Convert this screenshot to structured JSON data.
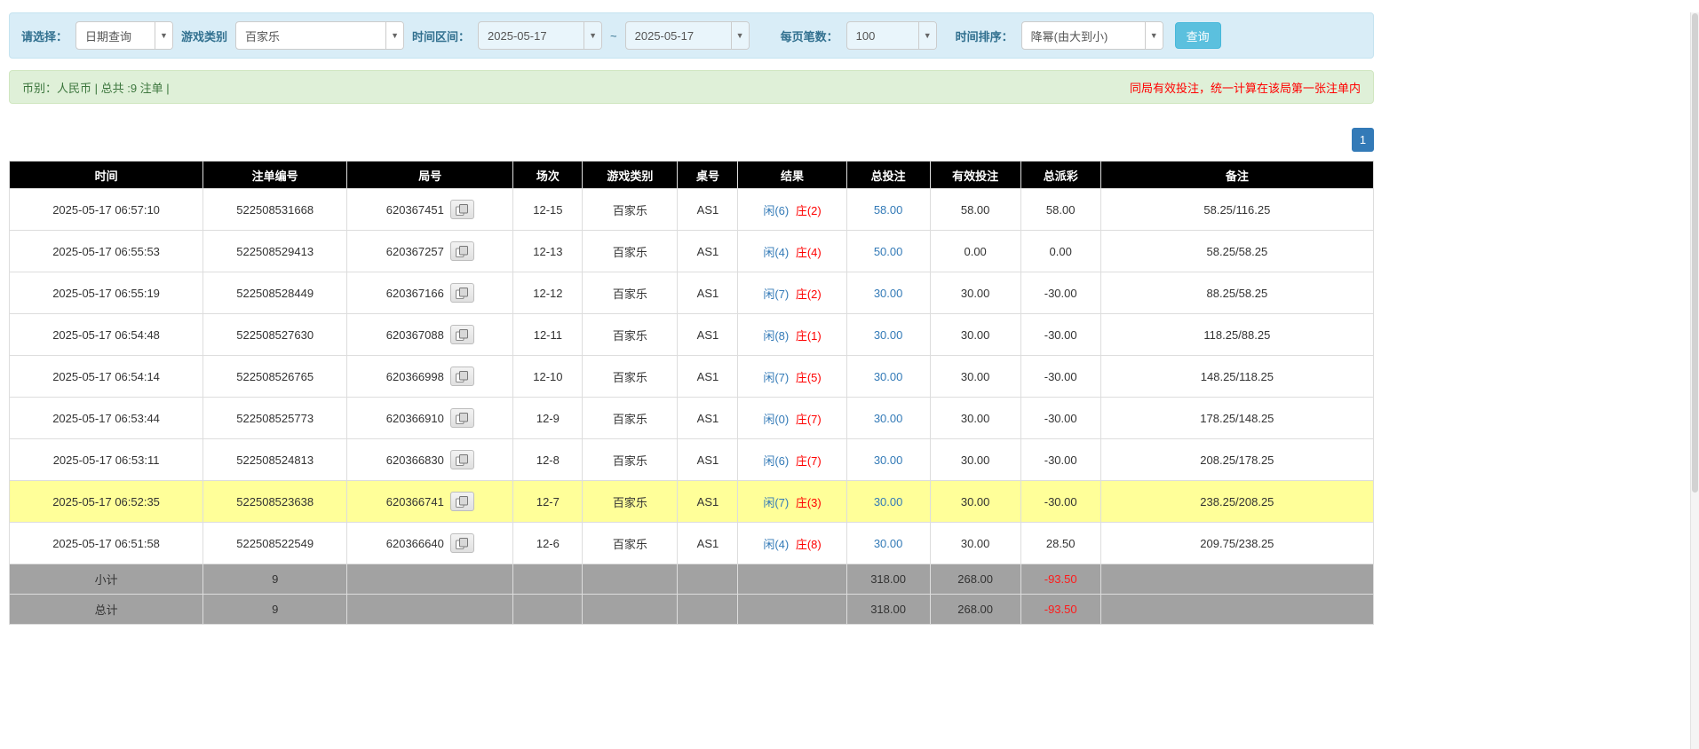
{
  "filters": {
    "select_label": "请选择：",
    "select_value": "日期查询",
    "game_label": "游戏类别",
    "game_value": "百家乐",
    "time_label": "时间区间：",
    "date_from": "2025-05-17",
    "range_separator": "~",
    "date_to": "2025-05-17",
    "per_page_label": "每页笔数：",
    "per_page_value": "100",
    "sort_label": "时间排序：",
    "sort_value": "降幂(由大到小)",
    "query_button": "查询"
  },
  "info_bar": {
    "left": "币别：人民币 | 总共 :9 注单 |",
    "right": "同局有效投注，统一计算在该局第一张注单内"
  },
  "pagination": {
    "current_page": "1"
  },
  "table": {
    "headers": [
      "时间",
      "注单编号",
      "局号",
      "场次",
      "游戏类别",
      "桌号",
      "结果",
      "总投注",
      "有效投注",
      "总派彩",
      "备注"
    ],
    "rows": [
      {
        "time": "2025-05-17 06:57:10",
        "bet_id": "522508531668",
        "round_id": "620367451",
        "session": "12-15",
        "game": "百家乐",
        "table_no": "AS1",
        "result_player": "闲(6)",
        "result_banker": "庄(2)",
        "total_bet": "58.00",
        "valid_bet": "58.00",
        "payout": "58.00",
        "remark": "58.25/116.25",
        "highlighted": false
      },
      {
        "time": "2025-05-17 06:55:53",
        "bet_id": "522508529413",
        "round_id": "620367257",
        "session": "12-13",
        "game": "百家乐",
        "table_no": "AS1",
        "result_player": "闲(4)",
        "result_banker": "庄(4)",
        "total_bet": "50.00",
        "valid_bet": "0.00",
        "payout": "0.00",
        "remark": "58.25/58.25",
        "highlighted": false
      },
      {
        "time": "2025-05-17 06:55:19",
        "bet_id": "522508528449",
        "round_id": "620367166",
        "session": "12-12",
        "game": "百家乐",
        "table_no": "AS1",
        "result_player": "闲(7)",
        "result_banker": "庄(2)",
        "total_bet": "30.00",
        "valid_bet": "30.00",
        "payout": "-30.00",
        "remark": "88.25/58.25",
        "highlighted": false
      },
      {
        "time": "2025-05-17 06:54:48",
        "bet_id": "522508527630",
        "round_id": "620367088",
        "session": "12-11",
        "game": "百家乐",
        "table_no": "AS1",
        "result_player": "闲(8)",
        "result_banker": "庄(1)",
        "total_bet": "30.00",
        "valid_bet": "30.00",
        "payout": "-30.00",
        "remark": "118.25/88.25",
        "highlighted": false
      },
      {
        "time": "2025-05-17 06:54:14",
        "bet_id": "522508526765",
        "round_id": "620366998",
        "session": "12-10",
        "game": "百家乐",
        "table_no": "AS1",
        "result_player": "闲(7)",
        "result_banker": "庄(5)",
        "total_bet": "30.00",
        "valid_bet": "30.00",
        "payout": "-30.00",
        "remark": "148.25/118.25",
        "highlighted": false
      },
      {
        "time": "2025-05-17 06:53:44",
        "bet_id": "522508525773",
        "round_id": "620366910",
        "session": "12-9",
        "game": "百家乐",
        "table_no": "AS1",
        "result_player": "闲(0)",
        "result_banker": "庄(7)",
        "total_bet": "30.00",
        "valid_bet": "30.00",
        "payout": "-30.00",
        "remark": "178.25/148.25",
        "highlighted": false
      },
      {
        "time": "2025-05-17 06:53:11",
        "bet_id": "522508524813",
        "round_id": "620366830",
        "session": "12-8",
        "game": "百家乐",
        "table_no": "AS1",
        "result_player": "闲(6)",
        "result_banker": "庄(7)",
        "total_bet": "30.00",
        "valid_bet": "30.00",
        "payout": "-30.00",
        "remark": "208.25/178.25",
        "highlighted": false
      },
      {
        "time": "2025-05-17 06:52:35",
        "bet_id": "522508523638",
        "round_id": "620366741",
        "session": "12-7",
        "game": "百家乐",
        "table_no": "AS1",
        "result_player": "闲(7)",
        "result_banker": "庄(3)",
        "total_bet": "30.00",
        "valid_bet": "30.00",
        "payout": "-30.00",
        "remark": "238.25/208.25",
        "highlighted": true
      },
      {
        "time": "2025-05-17 06:51:58",
        "bet_id": "522508522549",
        "round_id": "620366640",
        "session": "12-6",
        "game": "百家乐",
        "table_no": "AS1",
        "result_player": "闲(4)",
        "result_banker": "庄(8)",
        "total_bet": "30.00",
        "valid_bet": "30.00",
        "payout": "28.50",
        "remark": "209.75/238.25",
        "highlighted": false
      }
    ],
    "subtotal": {
      "label": "小计",
      "count": "9",
      "total_bet": "318.00",
      "valid_bet": "268.00",
      "payout": "-93.50"
    },
    "total": {
      "label": "总计",
      "count": "9",
      "total_bet": "318.00",
      "valid_bet": "268.00",
      "payout": "-93.50"
    }
  },
  "colors": {
    "accent_blue": "#337ab7",
    "player_blue": "#337ab7",
    "banker_red": "#ff0000",
    "negative_red": "#ff0000",
    "highlight_yellow": "#ffff99",
    "header_black": "#000000",
    "filter_bar_blue": "#d9edf7",
    "info_bar_green": "#dff0d8",
    "query_button_cyan": "#5bc0de"
  }
}
